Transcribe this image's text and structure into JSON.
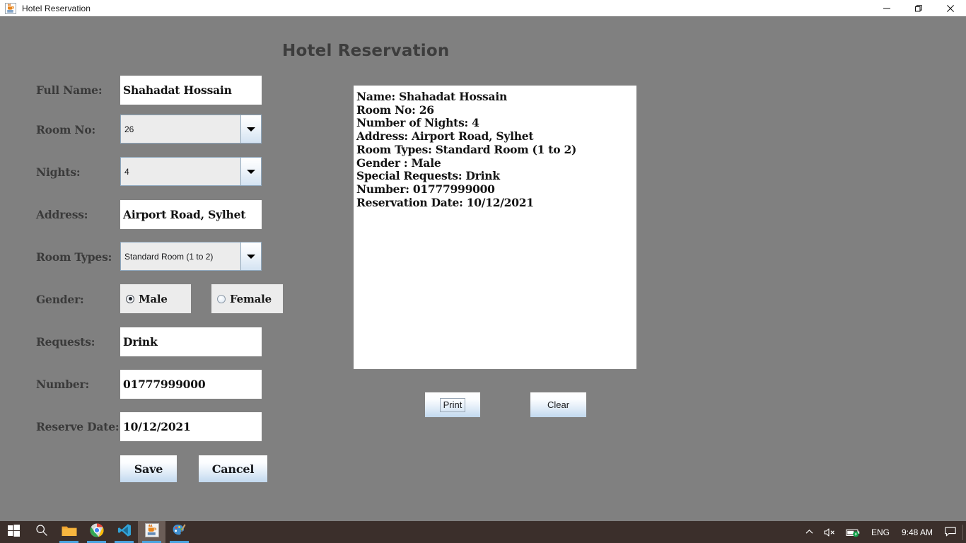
{
  "window": {
    "title": "Hotel Reservation",
    "icon": "java-coffee-icon",
    "controls": {
      "minimize": "minimize-icon",
      "restore": "restore-icon",
      "close": "close-icon"
    }
  },
  "app": {
    "heading": "Hotel Reservation",
    "background_color": "#808080",
    "fields": [
      {
        "label": "Full Name:",
        "type": "text",
        "value": "Shahadat Hossain"
      },
      {
        "label": "Room No:",
        "type": "combo",
        "value": "26"
      },
      {
        "label": "Nights:",
        "type": "combo",
        "value": "4"
      },
      {
        "label": "Address:",
        "type": "text",
        "value": "Airport Road, Sylhet"
      },
      {
        "label": "Room Types:",
        "type": "combo",
        "value": "Standard Room (1 to 2)"
      },
      {
        "label": "Gender:",
        "type": "radio",
        "value": "Male"
      },
      {
        "label": "Requests:",
        "type": "text",
        "value": "Drink"
      },
      {
        "label": "Number:",
        "type": "text",
        "value": "01777999000"
      },
      {
        "label": "Reserve Date:",
        "type": "text",
        "value": "10/12/2021"
      }
    ],
    "gender": {
      "male_label": "Male",
      "female_label": "Female",
      "selected": "Male"
    },
    "form_buttons": {
      "save": "Save",
      "cancel": "Cancel"
    },
    "output_buttons": {
      "print": "Print",
      "clear": "Clear",
      "focused": "Print"
    },
    "output_panel": {
      "lines": [
        "Name: Shahadat Hossain",
        "Room No: 26",
        "Number of Nights: 4",
        "Address: Airport Road, Sylhet",
        "Room Types: Standard Room (1 to 2)",
        "Gender : Male",
        "Special Requests: Drink",
        "Number: 01777999000",
        "Reservation Date: 10/12/2021"
      ]
    }
  },
  "taskbar": {
    "items": [
      {
        "name": "start-button",
        "icon": "windows-logo-icon",
        "active": false
      },
      {
        "name": "search-button",
        "icon": "search-icon",
        "active": false
      },
      {
        "name": "file-explorer-button",
        "icon": "folder-icon",
        "active": false
      },
      {
        "name": "chrome-button",
        "icon": "chrome-icon",
        "active": false
      },
      {
        "name": "vscode-button",
        "icon": "vscode-icon",
        "active": false
      },
      {
        "name": "java-app-button",
        "icon": "java-coffee-icon",
        "active": true
      },
      {
        "name": "paint-button",
        "icon": "paint-palette-icon",
        "active": false
      }
    ],
    "tray": {
      "overflow": "chevron-up-icon",
      "volume": "speaker-muted-icon",
      "battery": "battery-charging-icon",
      "language": "ENG",
      "clock": "9:48 AM",
      "notifications": "notification-icon"
    }
  }
}
